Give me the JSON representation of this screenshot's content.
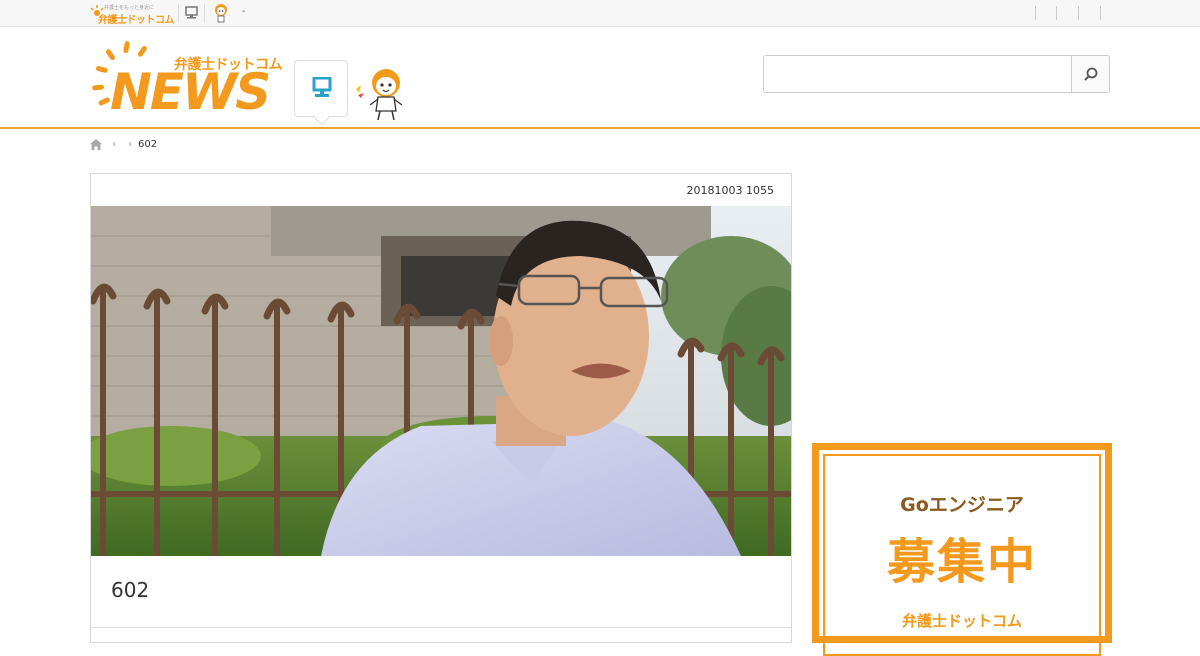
{
  "topbar": {
    "mini_logo_text": "弁護士ドットコム",
    "mini_logo_sub": "弁護士をもっと身近に",
    "dash": "-"
  },
  "header": {
    "logo_jp": "弁護士ドットコム",
    "logo_en": "NEWS"
  },
  "search": {
    "value": "",
    "placeholder": ""
  },
  "breadcrumb": {
    "home_icon": "home-icon",
    "current": "602"
  },
  "article": {
    "date": "20181003 1055",
    "title": "602"
  },
  "banner": {
    "line1": "Goエンジニア",
    "line2": "募集中",
    "line3": "弁護士ドットコム"
  },
  "colors": {
    "brand_orange": "#f39a1e",
    "header_rule": "#e8a42c",
    "pc_icon": "#2aa3c9"
  }
}
